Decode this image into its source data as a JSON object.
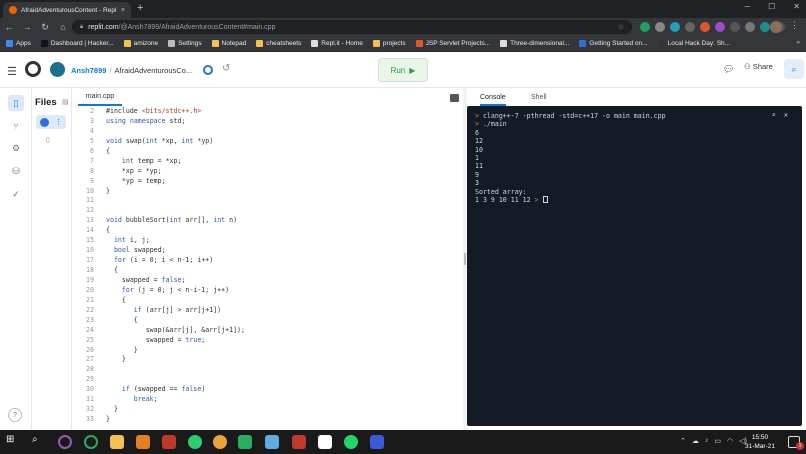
{
  "browser": {
    "tab_title": "AfraidAdventurousContent - Repl",
    "tab_close": "×",
    "new_tab": "+",
    "url_main": "replit.com",
    "url_rest": "/@Ansh7899/AfraidAdventurousContent#main.cpp",
    "bookmarks": [
      "Apps",
      "Dashboard | Hacker...",
      "amizone",
      "Settings",
      "Notepad",
      "cheatsheets",
      "Repl.it - Home",
      "projects",
      "JSP Servlet Projects...",
      "Three-dimensional...",
      "Getting Started on...",
      "Local Hack Day: Sh..."
    ]
  },
  "header": {
    "username": "Ansh7899",
    "separator": "/",
    "repl_name": "AfraidAdventurousCo...",
    "run_label": "Run",
    "share_label": "Share"
  },
  "files_panel": {
    "title": "Files"
  },
  "editor": {
    "tab_label": "main.cpp"
  },
  "console": {
    "tabs": [
      "Console",
      "Shell"
    ],
    "command": "clang++-7 -pthread -std=c++17 -o main main.cpp",
    "run_cmd": "./main",
    "output": [
      "6",
      "12",
      "10",
      "1",
      "11",
      "9",
      "3",
      "Sorted array:",
      "1 3 9 10 11 12"
    ]
  },
  "code_lines": [
    {
      "n": "2",
      "t": "#include <bits/stdc++.h>"
    },
    {
      "n": "3",
      "t": "using namespace std;"
    },
    {
      "n": "4",
      "t": ""
    },
    {
      "n": "5",
      "t": "void swap(int *xp, int *yp)"
    },
    {
      "n": "6",
      "t": "{"
    },
    {
      "n": "7",
      "t": "    int temp = *xp;"
    },
    {
      "n": "8",
      "t": "    *xp = *yp;"
    },
    {
      "n": "9",
      "t": "    *yp = temp;"
    },
    {
      "n": "10",
      "t": "}"
    },
    {
      "n": "11",
      "t": ""
    },
    {
      "n": "12",
      "t": ""
    },
    {
      "n": "13",
      "t": "void bubbleSort(int arr[], int n)"
    },
    {
      "n": "14",
      "t": "{"
    },
    {
      "n": "15",
      "t": "  int i, j;"
    },
    {
      "n": "16",
      "t": "  bool swapped;"
    },
    {
      "n": "17",
      "t": "  for (i = 0; i < n-1; i++)"
    },
    {
      "n": "18",
      "t": "  {"
    },
    {
      "n": "19",
      "t": "    swapped = false;"
    },
    {
      "n": "20",
      "t": "    for (j = 0; j < n-i-1; j++)"
    },
    {
      "n": "21",
      "t": "    {"
    },
    {
      "n": "22",
      "t": "       if (arr[j] > arr[j+1])"
    },
    {
      "n": "23",
      "t": "       {"
    },
    {
      "n": "24",
      "t": "          swap(&arr[j], &arr[j+1]);"
    },
    {
      "n": "25",
      "t": "          swapped = true;"
    },
    {
      "n": "26",
      "t": "       }"
    },
    {
      "n": "27",
      "t": "    }"
    },
    {
      "n": "28",
      "t": ""
    },
    {
      "n": "29",
      "t": ""
    },
    {
      "n": "30",
      "t": "    if (swapped == false)"
    },
    {
      "n": "31",
      "t": "       break;"
    },
    {
      "n": "32",
      "t": "  }"
    },
    {
      "n": "33",
      "t": "}"
    }
  ],
  "taskbar": {
    "time": "15:50",
    "date": "31-Mar-21",
    "notification_count": "1"
  }
}
